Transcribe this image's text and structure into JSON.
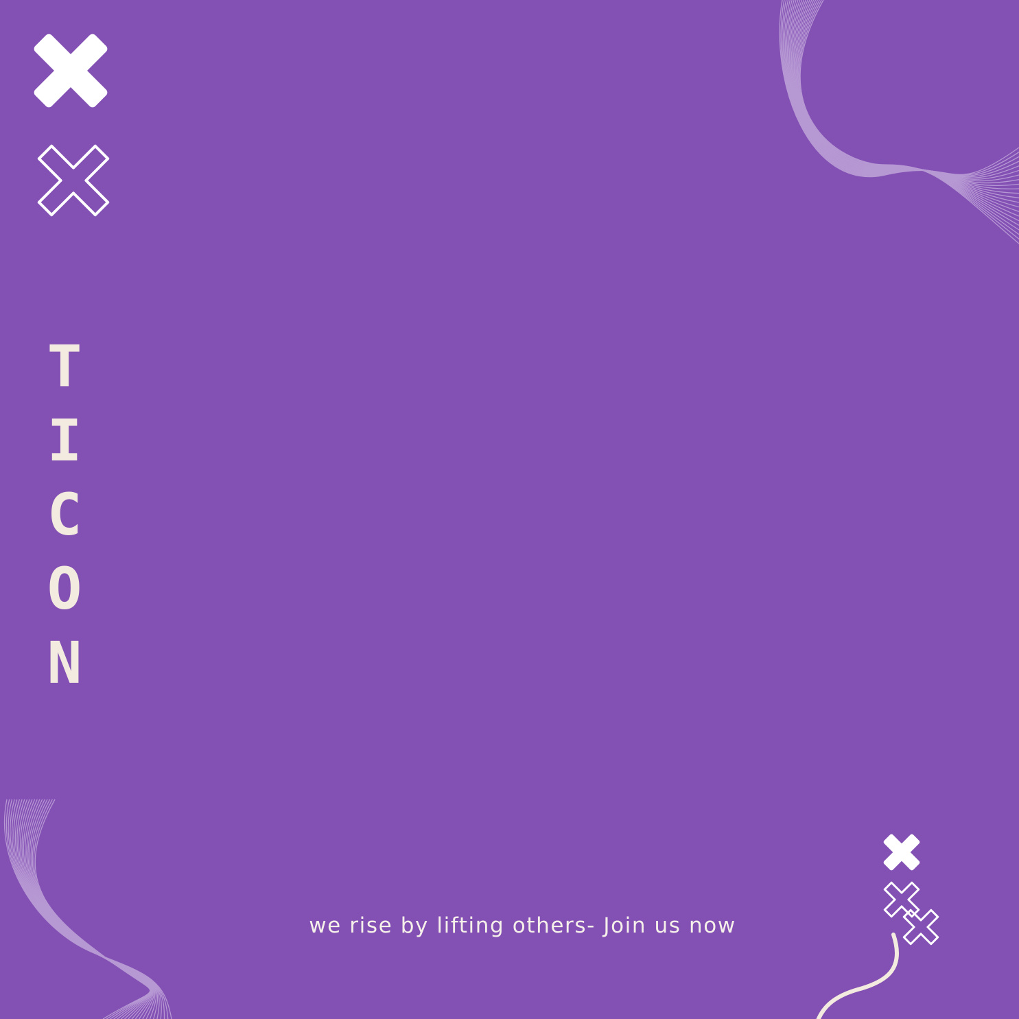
{
  "title": {
    "letters": [
      "T",
      "I",
      "C",
      "O",
      "N"
    ]
  },
  "tagline": "we rise by lifting others- Join us now",
  "colors": {
    "background": "#8350b4",
    "title": "#f3ebdf",
    "tagline": "#f6f0ea",
    "cross_solid": "#ffffff",
    "cross_outline": "#ffffff",
    "wave_lines": "#c8b0de",
    "squiggle": "#f3ebdf"
  },
  "icons": {
    "top_left_solid": "solid-cross-icon",
    "top_left_outline": "outline-cross-icon",
    "bottom_right_solid": "solid-cross-icon",
    "bottom_right_outline": "outline-cross-icon"
  }
}
